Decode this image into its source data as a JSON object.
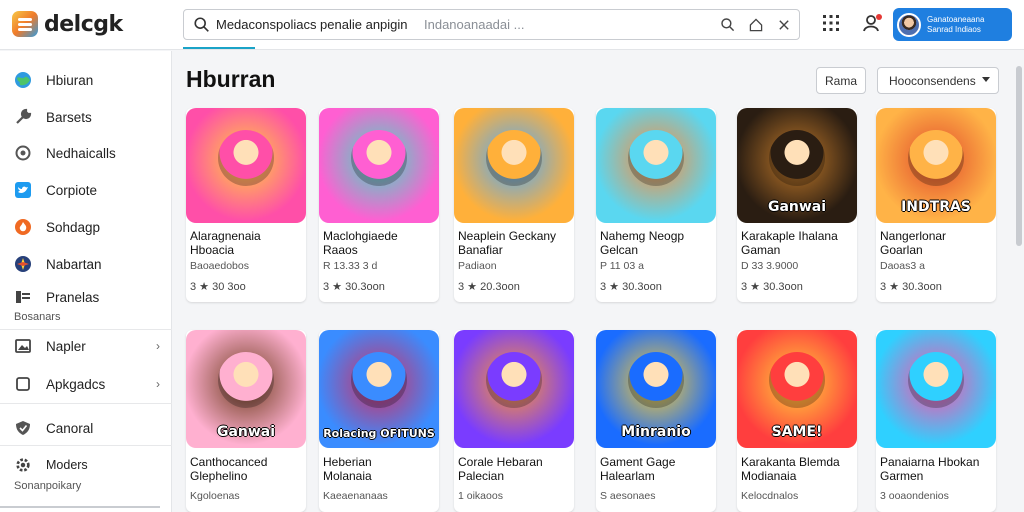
{
  "app": {
    "logo_text": "delcgk"
  },
  "search": {
    "query": "Medaconspoliacs penalie anpigin",
    "hint": "Indanoanaadai ..."
  },
  "account": {
    "line1": "Ganatoaneaana",
    "line2": "Sanrad Indiaos"
  },
  "sidebar": {
    "items": [
      {
        "label": "Hbiuran",
        "icon": "globe-icon"
      },
      {
        "label": "Barsets",
        "icon": "wrench-icon"
      },
      {
        "label": "Nedhaicalls",
        "icon": "refresh-icon"
      },
      {
        "label": "Corpiote",
        "icon": "twitter-icon"
      },
      {
        "label": "Sohdagp",
        "icon": "flame-icon"
      },
      {
        "label": "Nabartan",
        "icon": "compass-icon"
      },
      {
        "label": "Pranelas",
        "icon": "stack-icon"
      },
      {
        "label": "Napler",
        "icon": "image-icon"
      },
      {
        "label": "Apkgadcs",
        "icon": "square-icon"
      },
      {
        "label": "Canoral",
        "icon": "shield-icon"
      },
      {
        "label": "Moders",
        "icon": "gear-icon"
      }
    ],
    "sub_pranelas": "Bosanars",
    "sub_moders": "Sonanpoikary"
  },
  "main": {
    "title": "Hburran",
    "sort_label": "Rama",
    "filter_label": "Hooconsendens"
  },
  "cards": [
    {
      "name1": "Alaragnenaia",
      "name2": "Hboacia",
      "meta": "Baoaedobos",
      "rating": "3 ★ 30 3oo",
      "colors": [
        "#ff4fa8",
        "#ffd23a"
      ]
    },
    {
      "name1": "Maclohgiaede",
      "name2": "Raaos",
      "meta": "R 13.33 3 d",
      "rating": "3 ★ 30.3oon",
      "colors": [
        "#ff5fd2",
        "#40e0c0"
      ]
    },
    {
      "name1": "Neaplein Geckany",
      "name2": "Banafiar",
      "meta": "Padiaon",
      "rating": "3 ★ 20.3oon",
      "colors": [
        "#ffb03a",
        "#4aa8ff"
      ]
    },
    {
      "name1": "Nahemg Neogp",
      "name2": "Gelcan",
      "meta": "P 11 03 a",
      "rating": "3 ★ 30.3oon",
      "colors": [
        "#5ad7f0",
        "#ff8a3a"
      ]
    },
    {
      "name1": "Karakaple Ihalana",
      "name2": "Gaman",
      "meta": "D 33 3.9000",
      "rating": "3 ★ 30.3oon",
      "colors": [
        "#2a1d12",
        "#c27a2a"
      ]
    },
    {
      "name1": "Nangerlonar",
      "name2": "Goarlan",
      "meta": "Daoas3 a",
      "rating": "3 ★ 30.3oon",
      "colors": [
        "#ffb347",
        "#e14b2b"
      ]
    },
    {
      "name1": "Canthocanced",
      "name2": "Glephelino",
      "meta": "Kgoloenas",
      "rating": "",
      "colors": [
        "#ffb0d0",
        "#6b3a1a"
      ]
    },
    {
      "name1": "Heberian",
      "name2": "Molanaia",
      "meta": "Kaeaenanaas",
      "rating": "",
      "colors": [
        "#3a8cff",
        "#d22d63"
      ]
    },
    {
      "name1": "Corale Hebaran",
      "name2": "Palecian",
      "meta": "1 oikaoos",
      "rating": "",
      "colors": [
        "#7a3cff",
        "#ff9a2a"
      ]
    },
    {
      "name1": "Gament Gage",
      "name2": "Halearlam",
      "meta": "S aesonaes",
      "rating": "",
      "colors": [
        "#1a6cff",
        "#ffcd2a"
      ]
    },
    {
      "name1": "Karakanta  Blemda",
      "name2": "Modianaia",
      "meta": "Kelocdnalos",
      "rating": "",
      "colors": [
        "#ff3e3e",
        "#ffd23a"
      ]
    },
    {
      "name1": "Panaiarna Hbokan",
      "name2": "Garmen",
      "meta": "3 ooaondenios",
      "rating": "",
      "colors": [
        "#2fd0ff",
        "#ff4fa8"
      ]
    }
  ],
  "thumb_captions": [
    "",
    "",
    "",
    "",
    "Ganwai",
    "INDTRAS",
    "Ganwai",
    "Rolacing OFITUNS",
    "",
    "Minranio",
    "SAME!",
    ""
  ]
}
